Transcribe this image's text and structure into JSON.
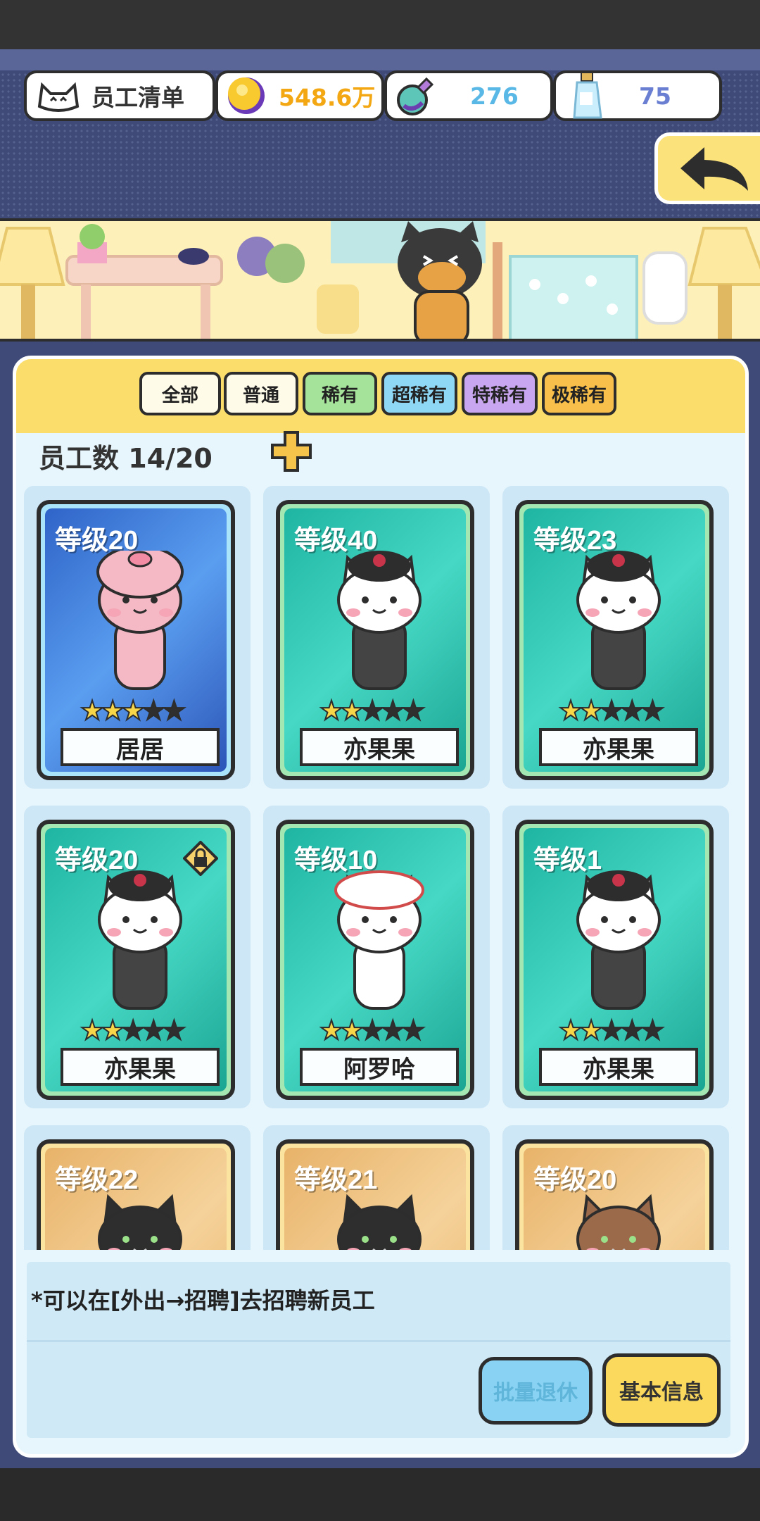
{
  "header": {
    "title": "员工清单",
    "coins": "548.6万",
    "potions": "276",
    "bottles": "75"
  },
  "filters": [
    {
      "label": "全部",
      "color": "#fffbe9"
    },
    {
      "label": "普通",
      "color": "#fffbe9"
    },
    {
      "label": "稀有",
      "color": "#a6e39a"
    },
    {
      "label": "超稀有",
      "color": "#8fd8f5"
    },
    {
      "label": "特稀有",
      "color": "#c9a6f0"
    },
    {
      "label": "极稀有",
      "color": "#f8c04a"
    }
  ],
  "staff_count": "员工数 14/20",
  "employees": [
    {
      "level": "等级20",
      "name": "居居",
      "stars": 3,
      "rarity": "blue"
    },
    {
      "level": "等级40",
      "name": "亦果果",
      "stars": 2,
      "rarity": "green"
    },
    {
      "level": "等级23",
      "name": "亦果果",
      "stars": 2,
      "rarity": "green"
    },
    {
      "level": "等级20",
      "name": "亦果果",
      "stars": 2,
      "rarity": "green",
      "locked": true
    },
    {
      "level": "等级10",
      "name": "阿罗哈",
      "stars": 2,
      "rarity": "green"
    },
    {
      "level": "等级1",
      "name": "亦果果",
      "stars": 2,
      "rarity": "green"
    },
    {
      "level": "等级22",
      "name": "",
      "stars": 0,
      "rarity": "gold"
    },
    {
      "level": "等级21",
      "name": "",
      "stars": 0,
      "rarity": "gold"
    },
    {
      "level": "等级20",
      "name": "",
      "stars": 0,
      "rarity": "gold"
    }
  ],
  "footer": {
    "hint": "*可以在[外出→招聘]去招聘新员工",
    "retire_button": "批量退休",
    "info_button": "基本信息"
  }
}
